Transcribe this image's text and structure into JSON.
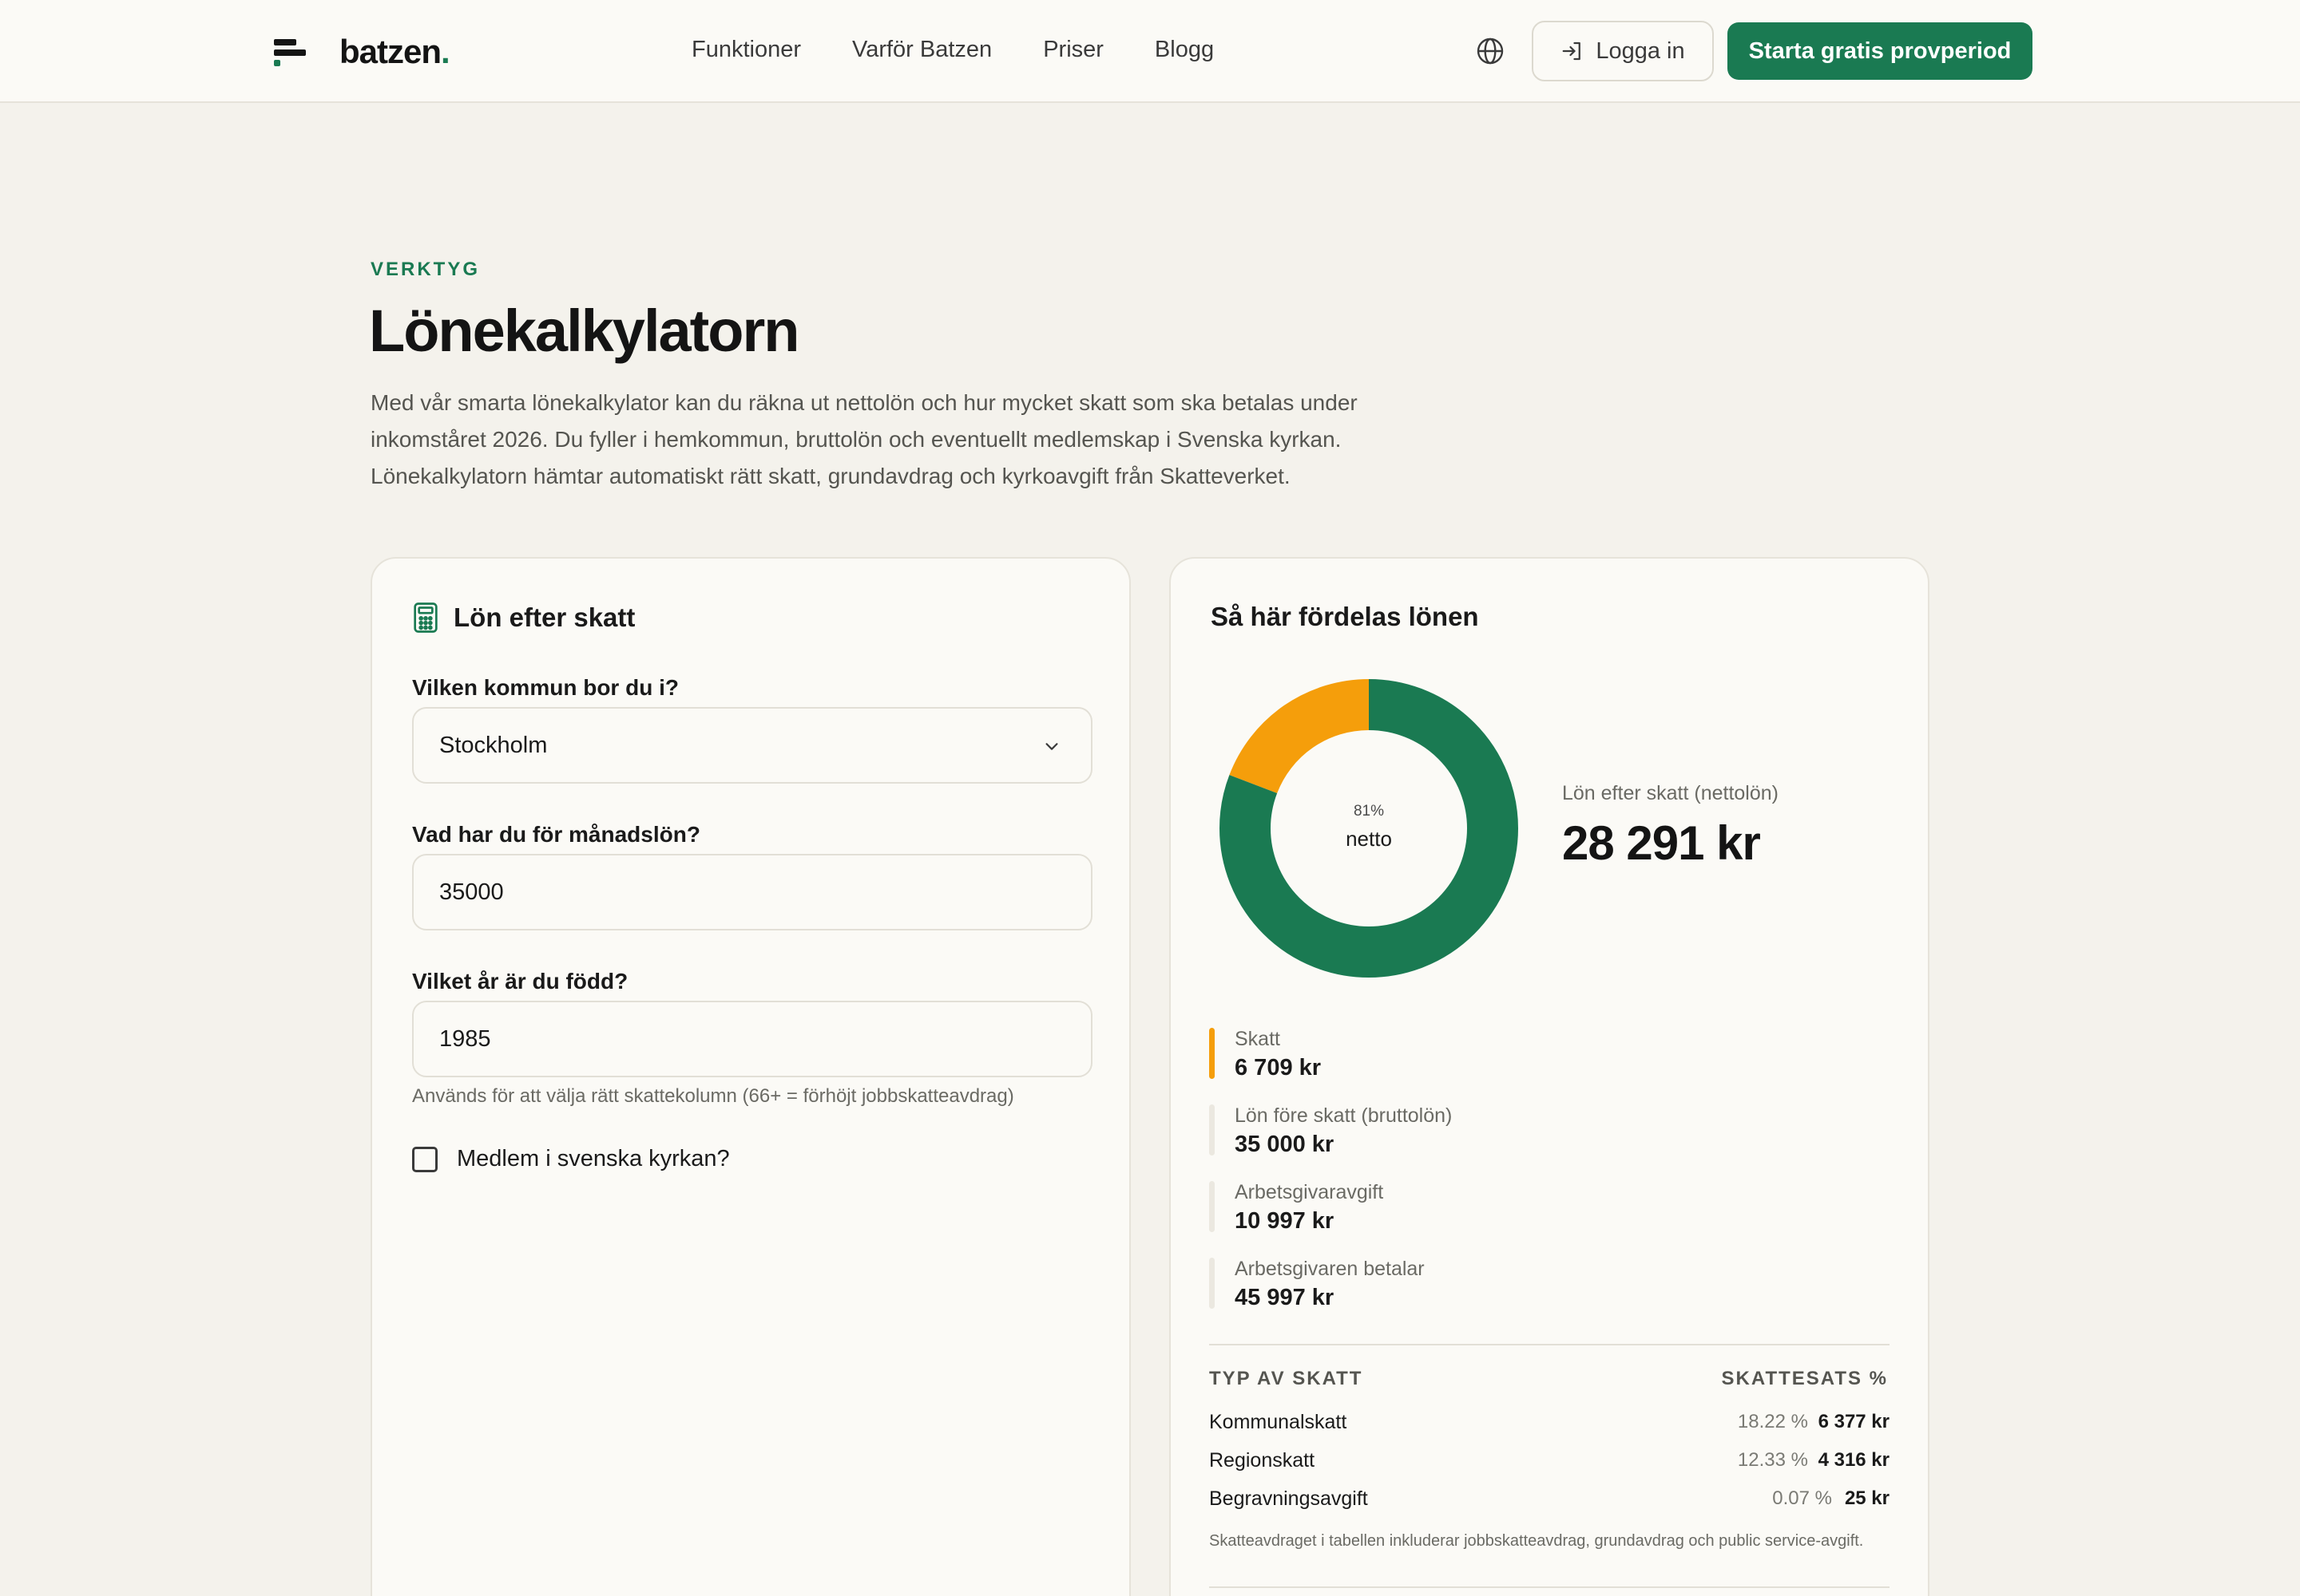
{
  "header": {
    "logo_text": "batzen",
    "logo_period": ".",
    "nav": [
      "Funktioner",
      "Varför Batzen",
      "Priser",
      "Blogg"
    ],
    "login_label": "Logga in",
    "cta_label": "Starta gratis provperiod"
  },
  "hero": {
    "eyebrow": "VERKTYG",
    "title": "Lönekalkylatorn",
    "intro": "Med vår smarta lönekalkylator kan du räkna ut nettolön och hur mycket skatt som ska betalas under inkomståret 2026. Du fyller i hemkommun, bruttolön och eventuellt medlemskap i Svenska kyrkan. Lönekalkylatorn hämtar automatiskt rätt skatt, grundavdrag och kyrkoavgift från Skatteverket."
  },
  "calculator": {
    "title": "Lön efter skatt",
    "municipality_label": "Vilken kommun bor du i?",
    "municipality_value": "Stockholm",
    "salary_label": "Vad har du för månadslön?",
    "salary_value": "35000",
    "birth_year_label": "Vilket år är du född?",
    "birth_year_value": "1985",
    "birth_year_hint": "Används för att välja rätt skattekolumn (66+ = förhöjt jobbskatteavdrag)",
    "church_label": "Medlem i svenska kyrkan?",
    "church_checked": false
  },
  "breakdown": {
    "title": "Så här fördelas lönen",
    "donut_center_pct": "81%",
    "donut_center_label": "netto",
    "net_label": "Lön efter skatt (nettolön)",
    "net_value": "28 291 kr",
    "legend": [
      {
        "label": "Skatt",
        "value": "6 709 kr",
        "color": "#f59e0b"
      },
      {
        "label": "Lön före skatt (bruttolön)",
        "value": "35 000 kr",
        "color": "#ebe8e0"
      },
      {
        "label": "Arbetsgivaravgift",
        "value": "10 997 kr",
        "color": "#ebe8e0"
      },
      {
        "label": "Arbetsgivaren betalar",
        "value": "45 997 kr",
        "color": "#ebe8e0"
      }
    ],
    "table_header_type": "TYP AV SKATT",
    "table_header_rate": "SKATTESATS %",
    "rows": [
      {
        "name": "Kommunalskatt",
        "rate": "18.22 %",
        "amount": "6 377 kr"
      },
      {
        "name": "Regionskatt",
        "rate": "12.33 %",
        "amount": "4 316 kr"
      },
      {
        "name": "Begravningsavgift",
        "rate": "0.07 %",
        "amount": "25 kr"
      }
    ],
    "footnote": "Skatteavdraget i tabellen inkluderar jobbskatteavdrag, grundavdrag och public service-avgift."
  },
  "chart_data": {
    "type": "pie",
    "categories": [
      "netto",
      "Skatt"
    ],
    "values": [
      28291,
      6709
    ],
    "colors": [
      "#1a7a52",
      "#f59e0b"
    ]
  }
}
